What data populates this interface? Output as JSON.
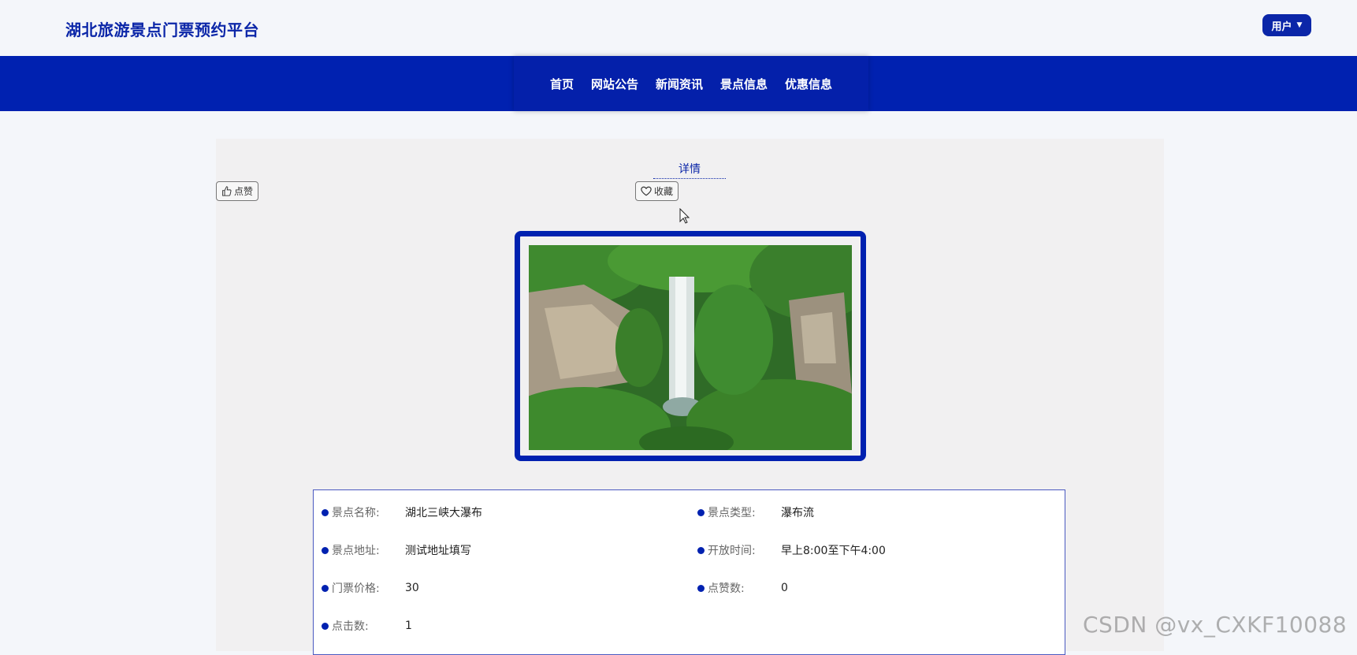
{
  "header": {
    "brand": "湖北旅游景点门票预约平台",
    "user_menu": "用户"
  },
  "nav": {
    "items": [
      "首页",
      "网站公告",
      "新闻资讯",
      "景点信息",
      "优惠信息"
    ]
  },
  "detail": {
    "title": "详情",
    "like_label": "点赞",
    "favorite_label": "收藏"
  },
  "info": {
    "name_label": "景点名称:",
    "name_value": "湖北三峡大瀑布",
    "type_label": "景点类型:",
    "type_value": "瀑布流",
    "address_label": "景点地址:",
    "address_value": "测试地址填写",
    "hours_label": "开放时间:",
    "hours_value": "早上8:00至下午4:00",
    "price_label": "门票价格:",
    "price_value": "30",
    "likes_label": "点赞数:",
    "likes_value": "0",
    "clicks_label": "点击数:",
    "clicks_value": "1"
  },
  "watermark": "CSDN @vx_CXKF10088",
  "colors": {
    "brand_blue": "#0021b0",
    "background": "#f4f6fa",
    "panel": "#f1f0f1"
  },
  "icons": {
    "like": "thumbs-up-icon",
    "favorite": "heart-icon",
    "user_caret": "caret-down-icon"
  }
}
